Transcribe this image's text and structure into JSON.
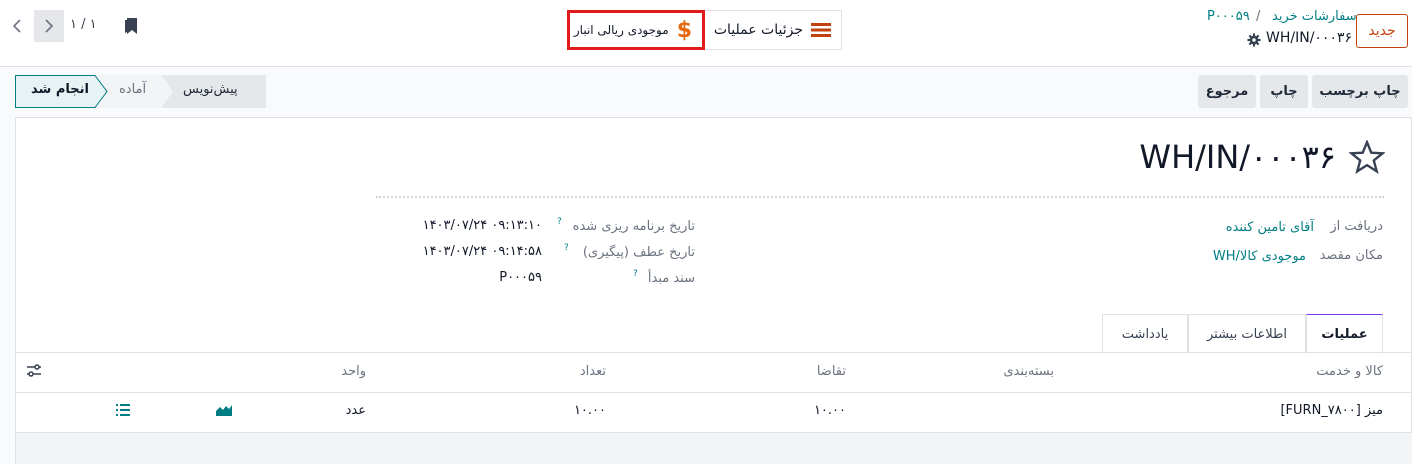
{
  "topbar": {
    "new_button": "جدید",
    "breadcrumb_parent": "سفارشات خرید",
    "breadcrumb_sep": "/",
    "breadcrumb_po": "P۰۰۰۵۹",
    "record_name": "WH/IN/۰۰۰۳۶",
    "smart_operations": "جزئیات عملیات",
    "smart_valuation": "موجودی ریالی انبار",
    "pager_value": "۱ / ۱"
  },
  "actions": {
    "print_labels": "چاپ برچسب",
    "print": "چاپ",
    "return": "مرجوع"
  },
  "status": {
    "draft": "پیش‌نویس",
    "ready": "آماده",
    "done": "انجام شد"
  },
  "form": {
    "title": "WH/IN/۰۰۰۳۶",
    "receive_from_label": "دریافت از",
    "receive_from_value": "آقای تامین کننده",
    "destination_label": "مکان مقصد",
    "destination_value": "WH/موجودی کالا",
    "scheduled_label": "تاریخ برنامه ریزی شده",
    "scheduled_value": "۱۴۰۳/۰۷/۲۴ ۰۹:۱۳:۱۰",
    "deadline_label": "تاریخ عطف (پیگیری)",
    "deadline_value": "۱۴۰۳/۰۷/۲۴ ۰۹:۱۴:۵۸",
    "origin_label": "سند مبدأ",
    "origin_value": "P۰۰۰۵۹",
    "help_mark": "?"
  },
  "tabs": [
    "عملیات",
    "اطلاعات بیشتر",
    "یادداشت"
  ],
  "table": {
    "headers": {
      "product": "کالا و خدمت",
      "packaging": "بسته‌بندی",
      "demand": "تقاضا",
      "quantity": "تعداد",
      "uom": "واحد"
    },
    "rows": [
      {
        "product": "[FURN_۷۸۰۰] میز",
        "demand": "۱۰.۰۰",
        "quantity": "۱۰.۰۰",
        "uom": "عدد"
      }
    ]
  },
  "colors": {
    "brand": "#c2410c",
    "link": "#017e84",
    "highlight": "#e01b1b"
  }
}
